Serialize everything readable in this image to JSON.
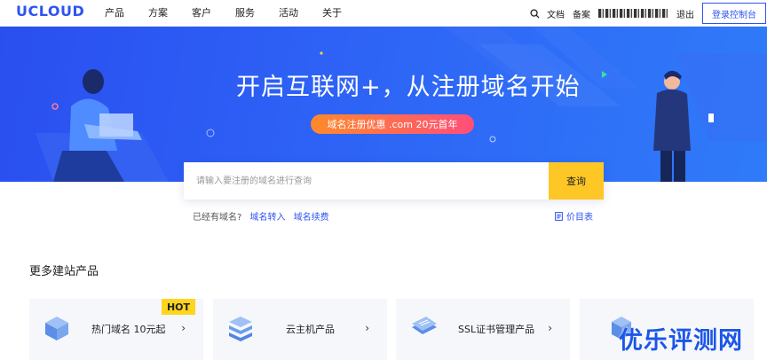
{
  "brand": {
    "logo": "UCLOUD",
    "accent": "#2e54f0"
  },
  "nav": {
    "menu": [
      "产品",
      "方案",
      "客户",
      "服务",
      "活动",
      "关于"
    ],
    "docs": "文档",
    "icp": "备案",
    "logout": "退出",
    "console": "登录控制台"
  },
  "hero": {
    "headline": "开启互联网+，从注册域名开始",
    "promo": "域名注册优惠 .com 20元首年"
  },
  "search": {
    "placeholder": "请输入要注册的域名进行查询",
    "button": "查询"
  },
  "sub_links": {
    "have_domain": "已经有域名?",
    "transfer": "域名转入",
    "renew": "域名续费",
    "price_list": "价目表"
  },
  "section": {
    "title": "更多建站产品"
  },
  "cards": [
    {
      "label": "热门域名 10元起",
      "badge": "HOT",
      "icon": "domain-cube-icon"
    },
    {
      "label": "云主机产品",
      "icon": "server-stack-icon"
    },
    {
      "label": "SSL证书管理产品",
      "icon": "ssl-card-icon"
    },
    {
      "label": "",
      "icon": "cube-stack-icon"
    }
  ],
  "watermark": "优乐评测网",
  "colors": {
    "hero": "#2e63f6",
    "search_button": "#ffc726",
    "hot": "#ffd41f"
  }
}
